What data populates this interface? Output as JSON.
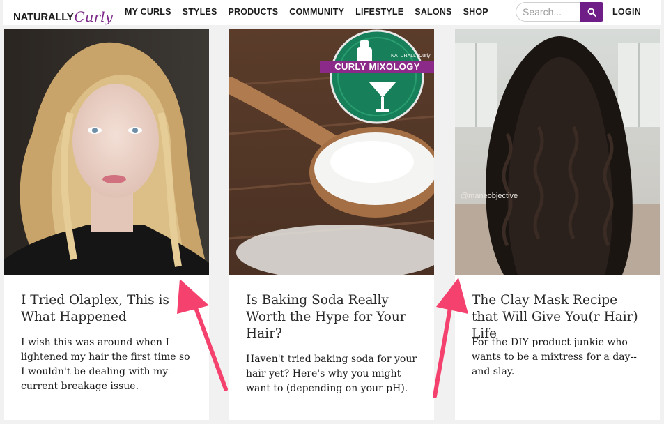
{
  "brand": {
    "logo_part1": "NATURALLY",
    "logo_part2": "Curly"
  },
  "nav": {
    "items": [
      "MY CURLS",
      "STYLES",
      "PRODUCTS",
      "COMMUNITY",
      "LIFESTYLE",
      "SALONS",
      "SHOP"
    ]
  },
  "search": {
    "placeholder": "Search...",
    "value": ""
  },
  "login_label": "LOGIN",
  "cards": [
    {
      "title": "I Tried Olaplex, This is What Happened",
      "excerpt": "I wish this was around when I lightened my hair the first time so I wouldn't be dealing with my current breakage issue."
    },
    {
      "title": "Is Baking Soda Really Worth the Hype for Your Hair?",
      "excerpt": "Haven't tried baking soda for your hair yet? Here's why you might want to (depending on your pH).",
      "badge": {
        "small": "NATURALLY Curly",
        "label": "CURLY MIXOLOGY"
      }
    },
    {
      "title": "The Clay Mask Recipe that Will Give You(r Hair) Life",
      "excerpt": "For the DIY product junkie who wants to be a mixtress for a day--and slay.",
      "watermark": "@maneobjective"
    }
  ],
  "colors": {
    "brand_purple": "#6f1e87",
    "badge_purple": "#8c2a8a",
    "badge_green": "#17805a",
    "arrow": "#f5416e"
  }
}
